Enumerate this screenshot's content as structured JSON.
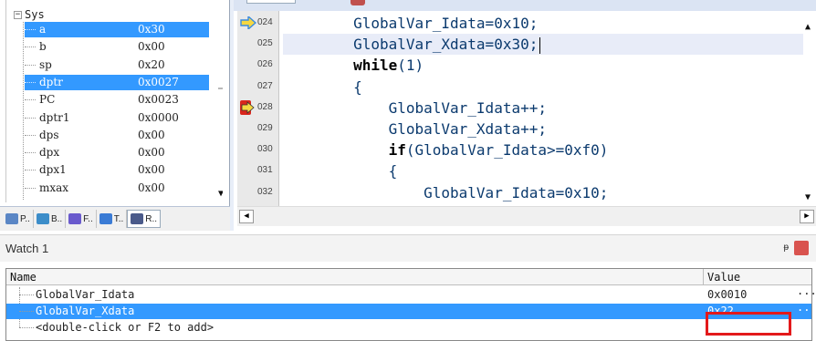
{
  "registers": {
    "group_label": "Sys",
    "rows": [
      {
        "name": "a",
        "value": "0x30",
        "selected": true
      },
      {
        "name": "b",
        "value": "0x00"
      },
      {
        "name": "sp",
        "value": "0x20"
      },
      {
        "name": "dptr",
        "value": "0x0027",
        "selected": true
      },
      {
        "name": "PC",
        "value": "0x0023"
      },
      {
        "name": "dptr1",
        "value": "0x0000"
      },
      {
        "name": "dps",
        "value": "0x00"
      },
      {
        "name": "dpx",
        "value": "0x00"
      },
      {
        "name": "dpx1",
        "value": "0x00"
      },
      {
        "name": "mxax",
        "value": "0x00"
      }
    ],
    "tabs": [
      {
        "label": "P..",
        "icon": "project-icon",
        "color": "#5a86c5"
      },
      {
        "label": "B..",
        "icon": "books-icon",
        "color": "#3c8dc9"
      },
      {
        "label": "F..",
        "icon": "functions-icon",
        "color": "#6a5acd"
      },
      {
        "label": "T..",
        "icon": "templates-icon",
        "color": "#3a7bd5"
      },
      {
        "label": "R..",
        "icon": "registers-icon",
        "color": "#4a5a8a"
      }
    ]
  },
  "editor": {
    "lines": [
      {
        "no": "024",
        "marker": "current",
        "text": "        GlobalVar_Idata=0x10;",
        "kw": null
      },
      {
        "no": "025",
        "marker": null,
        "text": "        GlobalVar_Xdata=0x30;",
        "kw": null,
        "caret": true,
        "current": true
      },
      {
        "no": "026",
        "marker": null,
        "pre": "        ",
        "kw": "while",
        "post": "(1)"
      },
      {
        "no": "027",
        "marker": null,
        "text": "        {",
        "kw": null
      },
      {
        "no": "028",
        "marker": "breakpoint",
        "text": "            GlobalVar_Idata++;",
        "kw": null
      },
      {
        "no": "029",
        "marker": null,
        "text": "            GlobalVar_Xdata++;",
        "kw": null
      },
      {
        "no": "030",
        "marker": null,
        "pre": "            ",
        "kw": "if",
        "post": "(GlobalVar_Idata>=0xf0)"
      },
      {
        "no": "031",
        "marker": null,
        "text": "            {",
        "kw": null
      },
      {
        "no": "032",
        "marker": null,
        "text": "                GlobalVar_Idata=0x10;",
        "kw": null
      }
    ],
    "marker_colors": {
      "current": "#f5d742",
      "breakpoint": "#d9261c"
    }
  },
  "watch": {
    "title": "Watch 1",
    "pin_label": "т",
    "col_name": "Name",
    "col_value": "Value",
    "rows": [
      {
        "name": "GlobalVar_Idata",
        "value": "0x0010",
        "more": "...",
        "selected": false
      },
      {
        "name": "GlobalVar_Xdata",
        "value": "0x22",
        "more": "..",
        "selected": true
      },
      {
        "name": "<double-click or F2 to add>",
        "value": "",
        "more": "",
        "selected": false
      }
    ]
  },
  "colors": {
    "selection": "#3399ff",
    "highlight_box": "#e3191b"
  }
}
